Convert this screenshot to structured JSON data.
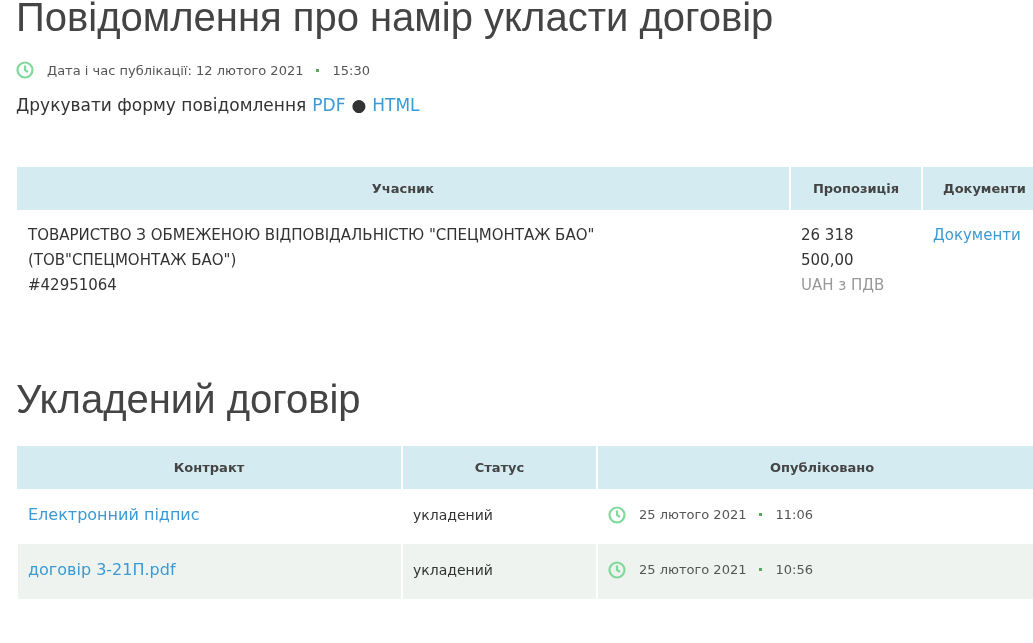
{
  "notice": {
    "title": "Повідомлення про намір укласти договір",
    "published_label": "Дата і час публікації: 12 лютого 2021",
    "published_time": "15:30",
    "print_label": "Друкувати форму повідомлення",
    "print_links": [
      "PDF",
      "HTML"
    ],
    "print_separator": "●"
  },
  "bids_table": {
    "columns": [
      "Учасник",
      "Пропозиція",
      "Документи"
    ],
    "rows": [
      {
        "participant": [
          "ТОВАРИСТВО З ОБМЕЖЕНОЮ ВІДПОВІДАЛЬНІСТЮ \"СПЕЦМОНТАЖ БАО\"",
          "(ТОВ\"СПЕЦМОНТАЖ БАО\")",
          "#42951064"
        ],
        "amount": [
          "26 318",
          "500,00"
        ],
        "currency": "UAH з ПДВ",
        "documents": "Документи"
      }
    ]
  },
  "contract": {
    "title": "Укладений договір",
    "columns": [
      "Контракт",
      "Статус",
      "Опубліковано"
    ],
    "rows": [
      {
        "name": "Електронний підпис",
        "status": "укладений",
        "date": "25 лютого 2021",
        "time": "11:06"
      },
      {
        "name": "договір 3-21П.pdf",
        "status": "укладений",
        "date": "25 лютого 2021",
        "time": "10:56"
      }
    ]
  }
}
